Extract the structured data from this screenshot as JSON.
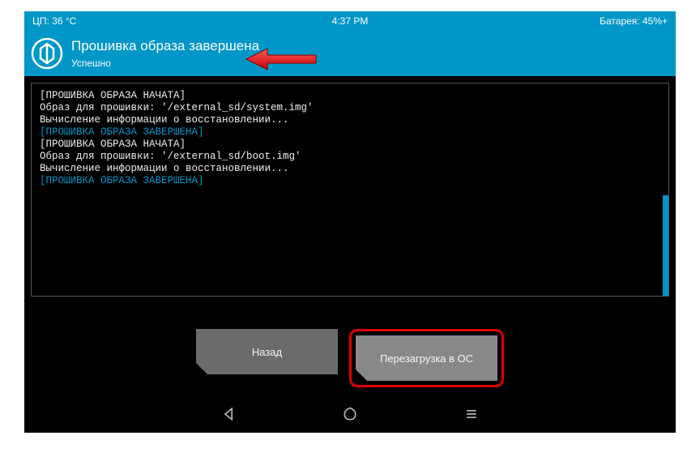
{
  "statusbar": {
    "cpu": "ЦП: 36 °C",
    "time": "4:37 PM",
    "battery": "Батарея: 45%+"
  },
  "header": {
    "title": "Прошивка образа завершена",
    "subtitle": "Успешно"
  },
  "log": {
    "lines": [
      {
        "text": "[ПРОШИВКА ОБРАЗА НАЧАТА]",
        "hl": false
      },
      {
        "text": "Образ для прошивки: '/external_sd/system.img'",
        "hl": false
      },
      {
        "text": "Вычисление информации о восстановлении...",
        "hl": false
      },
      {
        "text": "[ПРОШИВКА ОБРАЗА ЗАВЕРШЕНА]",
        "hl": true
      },
      {
        "text": "[ПРОШИВКА ОБРАЗА НАЧАТА]",
        "hl": false
      },
      {
        "text": "Образ для прошивки: '/external_sd/boot.img'",
        "hl": false
      },
      {
        "text": "Вычисление информации о восстановлении...",
        "hl": false
      },
      {
        "text": "[ПРОШИВКА ОБРАЗА ЗАВЕРШЕНА]",
        "hl": true
      }
    ]
  },
  "buttons": {
    "back": "Назад",
    "reboot": "Перезагрузка в ОС"
  }
}
